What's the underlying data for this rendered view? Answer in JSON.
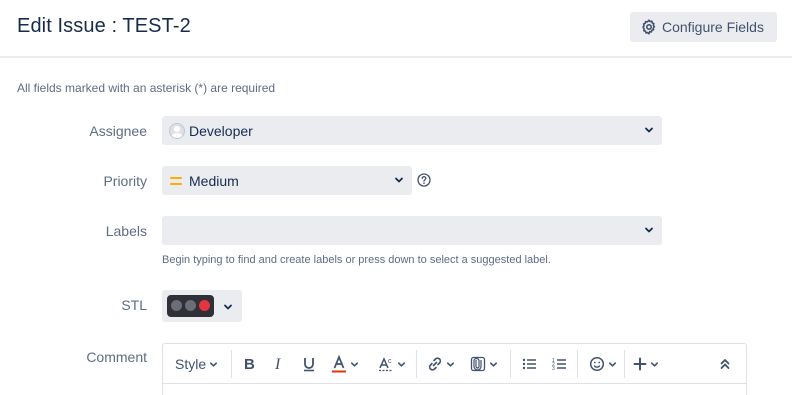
{
  "header": {
    "title": "Edit Issue : TEST-2",
    "configure_label": "Configure Fields"
  },
  "form": {
    "required_note": "All fields marked with an asterisk (*) are required",
    "assignee": {
      "label": "Assignee",
      "value": "Developer"
    },
    "priority": {
      "label": "Priority",
      "value": "Medium"
    },
    "labels": {
      "label": "Labels",
      "value": "",
      "hint": "Begin typing to find and create labels or press down to select a suggested label."
    },
    "stl": {
      "label": "STL",
      "lights": [
        "#6b6e76",
        "#6b6e76",
        "#e5343f"
      ]
    },
    "comment": {
      "label": "Comment",
      "toolbar": {
        "style_label": "Style",
        "buttons": [
          "bold",
          "italic",
          "underline",
          "text-color",
          "text-effects",
          "link",
          "attachment",
          "bullet-list",
          "numbered-list",
          "emoji",
          "insert",
          "collapse"
        ]
      }
    }
  },
  "colors": {
    "accent_text_color": "#de350b",
    "priority": "#ffab00"
  }
}
